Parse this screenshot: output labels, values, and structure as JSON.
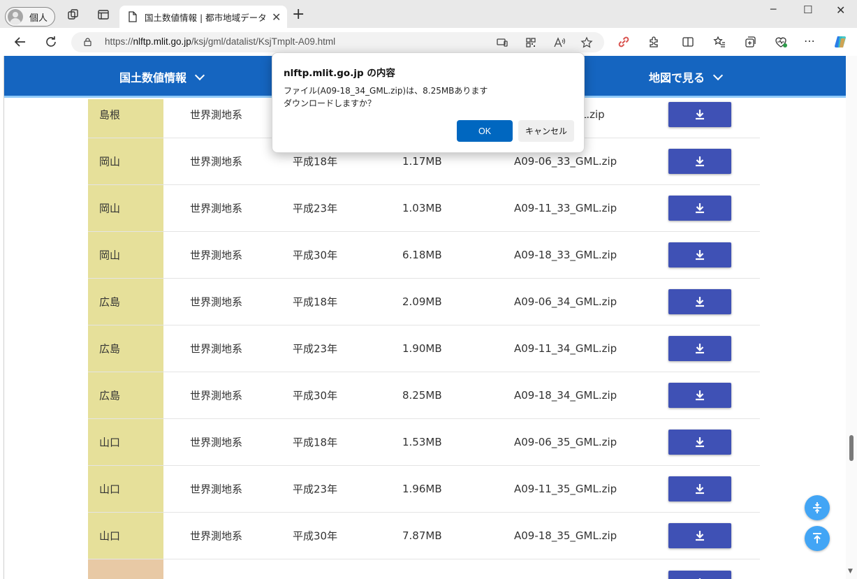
{
  "browser": {
    "profile_label": "個人",
    "tab_title": "国土数値情報 | 都市地域データ",
    "url_host": "nlftp.mlit.go.jp",
    "url_prefix": "https://",
    "url_path": "/ksj/gml/datalist/KsjTmplt-A09.html",
    "accent_color": "#0067c0"
  },
  "site_header": {
    "nav_left": "国土数値情報",
    "nav_right": "地図で見る",
    "bg_color": "#1565c0"
  },
  "table": {
    "rows": [
      {
        "pref": "島根",
        "system": "世界測地系",
        "year": "",
        "size": "",
        "file": "",
        "file_suffix": "L.zip"
      },
      {
        "pref": "岡山",
        "system": "世界測地系",
        "year": "平成18年",
        "size": "1.17MB",
        "file": "A09-06_33_GML.zip"
      },
      {
        "pref": "岡山",
        "system": "世界測地系",
        "year": "平成23年",
        "size": "1.03MB",
        "file": "A09-11_33_GML.zip"
      },
      {
        "pref": "岡山",
        "system": "世界測地系",
        "year": "平成30年",
        "size": "6.18MB",
        "file": "A09-18_33_GML.zip"
      },
      {
        "pref": "広島",
        "system": "世界測地系",
        "year": "平成18年",
        "size": "2.09MB",
        "file": "A09-06_34_GML.zip"
      },
      {
        "pref": "広島",
        "system": "世界測地系",
        "year": "平成23年",
        "size": "1.90MB",
        "file": "A09-11_34_GML.zip"
      },
      {
        "pref": "広島",
        "system": "世界測地系",
        "year": "平成30年",
        "size": "8.25MB",
        "file": "A09-18_34_GML.zip"
      },
      {
        "pref": "山口",
        "system": "世界測地系",
        "year": "平成18年",
        "size": "1.53MB",
        "file": "A09-06_35_GML.zip"
      },
      {
        "pref": "山口",
        "system": "世界測地系",
        "year": "平成23年",
        "size": "1.96MB",
        "file": "A09-11_35_GML.zip"
      },
      {
        "pref": "山口",
        "system": "世界測地系",
        "year": "平成30年",
        "size": "7.87MB",
        "file": "A09-18_35_GML.zip"
      }
    ],
    "pref_bg_color": "#e6e09a",
    "button_color": "#3f51b5"
  },
  "dialog": {
    "title": "nlftp.mlit.go.jp の内容",
    "message_line1": "ファイル(A09-18_34_GML.zip)は、8.25MBあります",
    "message_line2": "ダウンロードしますか？",
    "ok_label": "OK",
    "cancel_label": "キャンセル"
  }
}
